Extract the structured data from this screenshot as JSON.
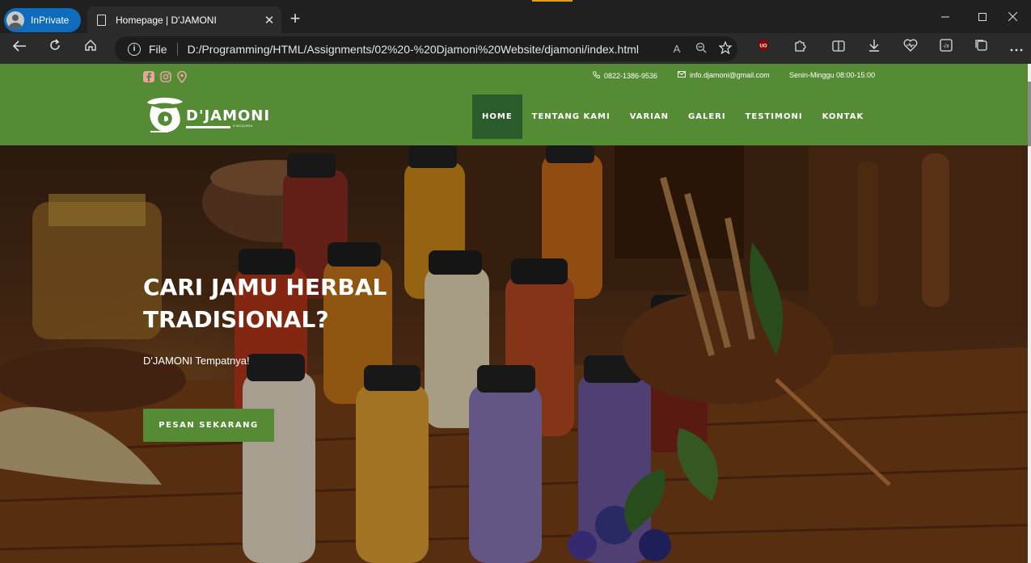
{
  "browser": {
    "inprivate_label": "InPrivate",
    "tab_title": "Homepage | D'JAMONI",
    "tab_close": "✕",
    "new_tab": "+",
    "address_scheme": "File",
    "address_url": "D:/Programming/HTML/Assignments/02%20-%20Djamoni%20Website/djamoni/index.html",
    "read_aloud": "A",
    "accent_color": "#0f6cbd"
  },
  "topbar": {
    "phone": "0822-1386-9536",
    "email": "info.djamoni@gmail.com",
    "hours": "Senin-Minggu 08:00-15:00"
  },
  "logo": {
    "brand": "D'JAMONI",
    "tagline": "D'ACQUIRA"
  },
  "nav": {
    "items": [
      "HOME",
      "TENTANG KAMI",
      "VARIAN",
      "GALERI",
      "TESTIMONI",
      "KONTAK"
    ],
    "active": "HOME"
  },
  "hero": {
    "title": "CARI JAMU HERBAL TRADISIONAL?",
    "subtitle": "D'JAMONI Tempatnya!",
    "cta": "PESAN SEKARANG"
  },
  "colors": {
    "brand_green": "#558b35",
    "nav_active": "#2a5c2b"
  }
}
